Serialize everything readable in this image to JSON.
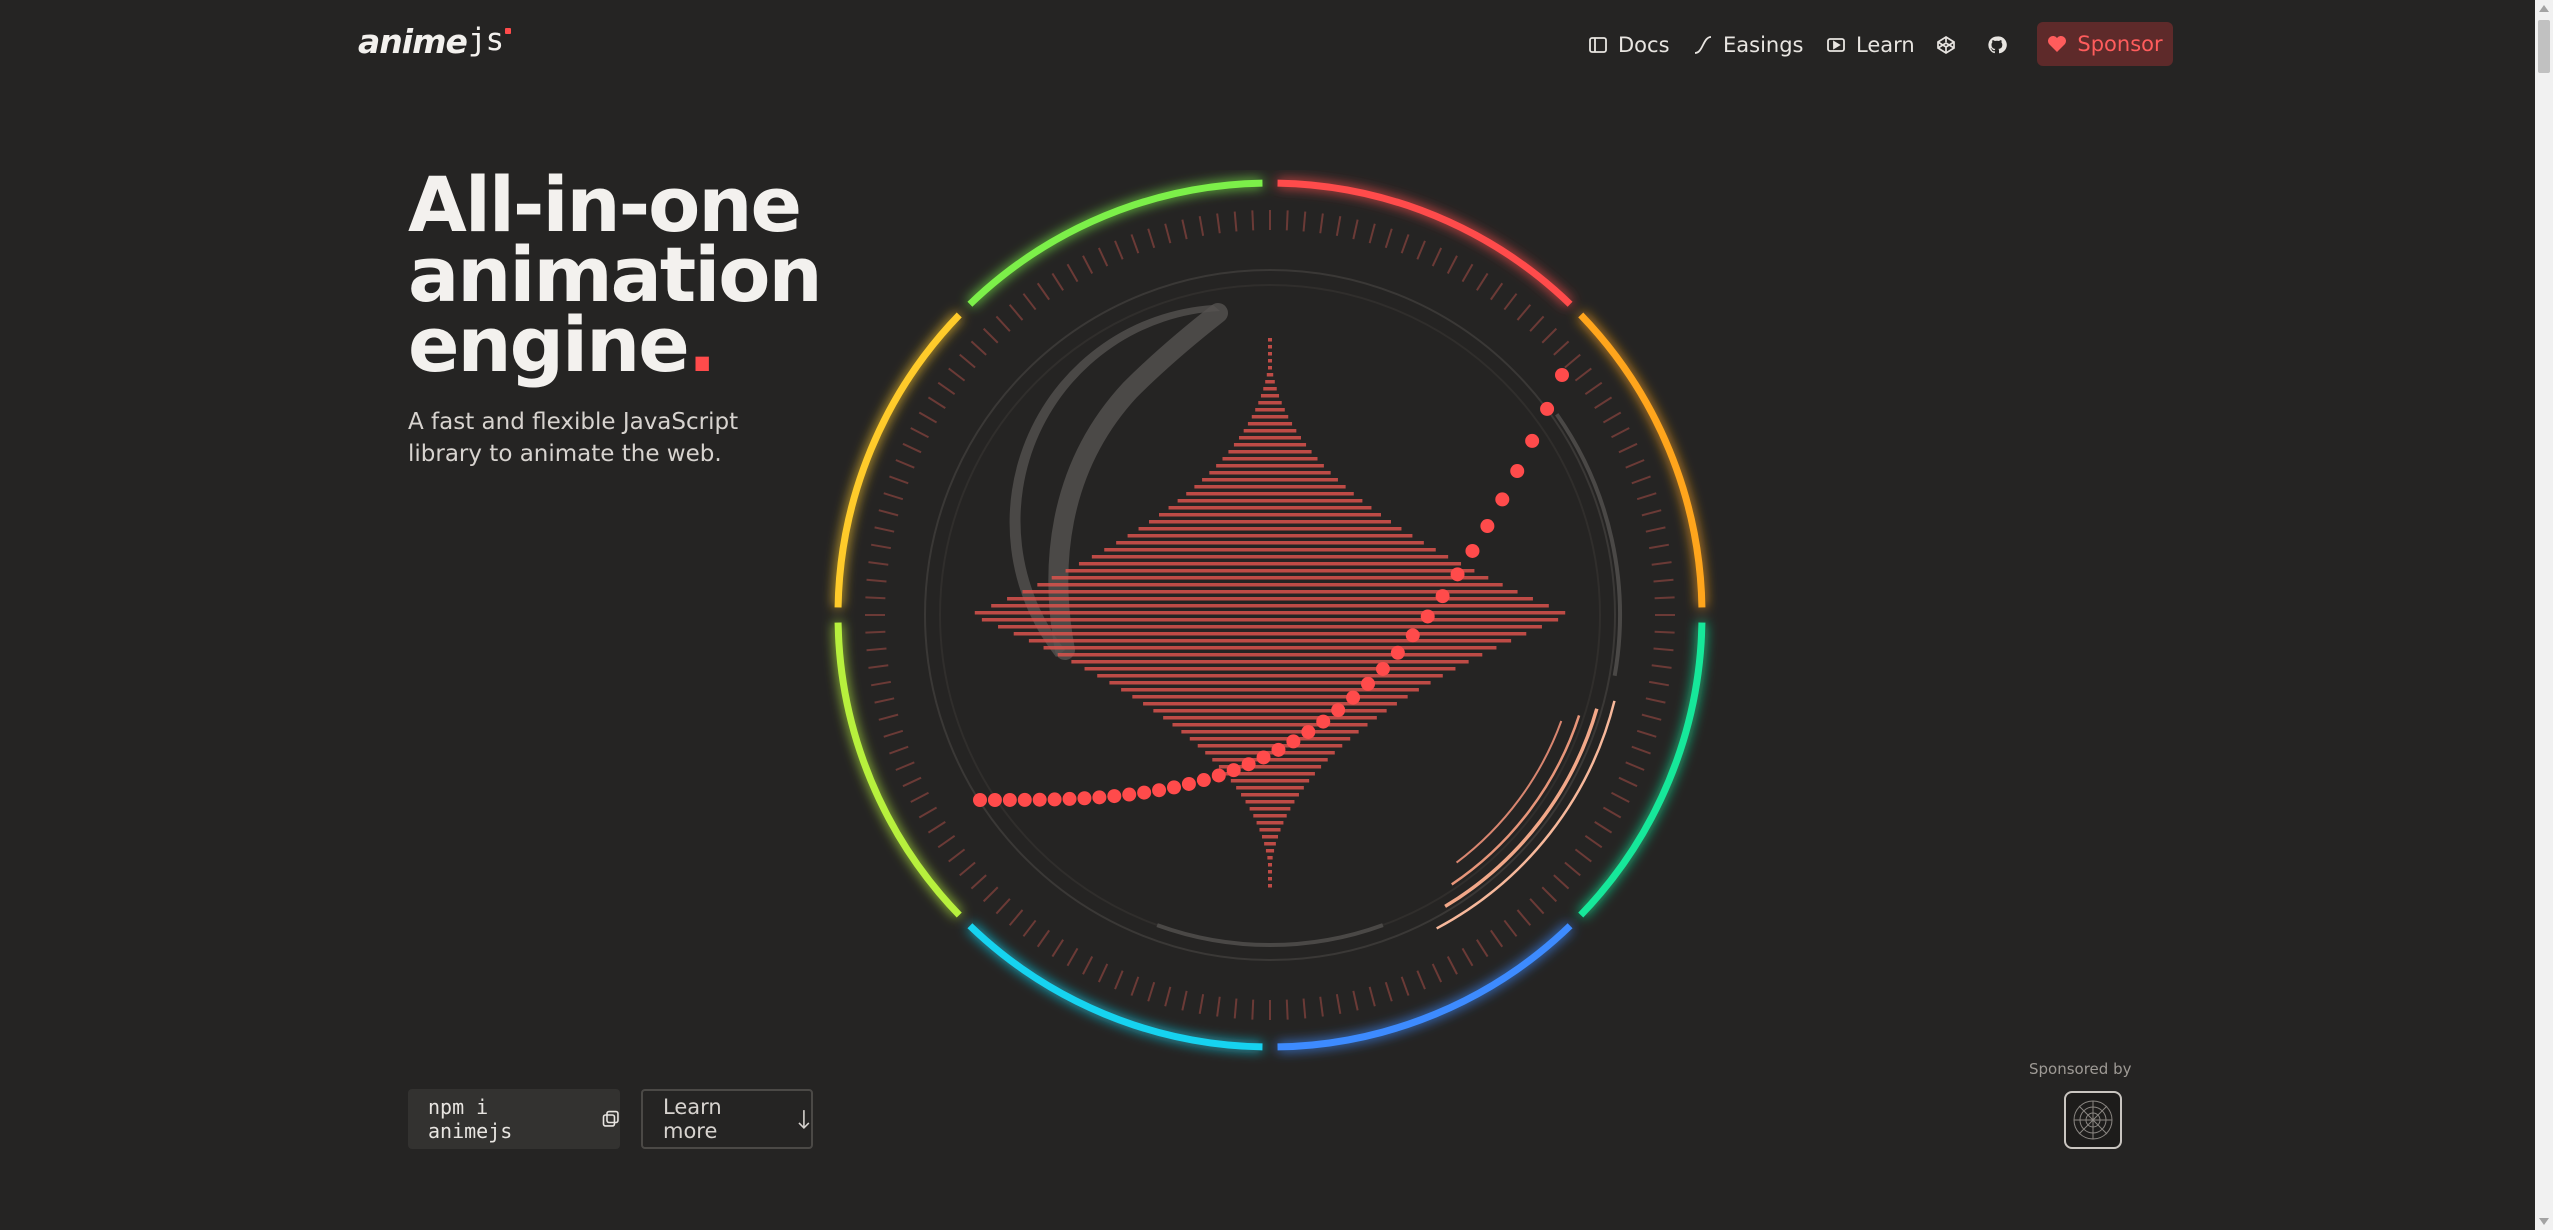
{
  "header": {
    "logo_text": "anime",
    "logo_suffix": "js",
    "nav": [
      {
        "label": "Docs",
        "icon": "book-icon"
      },
      {
        "label": "Easings",
        "icon": "curve-icon"
      },
      {
        "label": "Learn",
        "icon": "play-icon"
      }
    ],
    "codepen_icon": "codepen-icon",
    "github_icon": "github-icon",
    "sponsor_label": "Sponsor",
    "sponsor_icon": "heart-icon"
  },
  "hero": {
    "title_lines": [
      "All-in-one",
      "animation",
      "engine"
    ],
    "title_dot": ".",
    "subtitle": "A fast and flexible JavaScript library to animate the web."
  },
  "actions": {
    "install_command": "npm i animejs",
    "copy_icon": "copy-icon",
    "learn_more_label": "Learn more",
    "learn_more_icon": "arrow-down-icon"
  },
  "sponsored": {
    "label": "Sponsored by"
  },
  "colors": {
    "accent": "#ff4b4b",
    "background": "#252423",
    "ring_green": "#7cf04a",
    "ring_red": "#ff4b4b",
    "ring_orange": "#ffa51f",
    "ring_teal": "#15e89a",
    "ring_blue": "#3d8bff",
    "ring_cyan": "#19d3f0",
    "ring_yellow_green": "#b7f03c",
    "ring_yellow": "#ffcb2b"
  }
}
